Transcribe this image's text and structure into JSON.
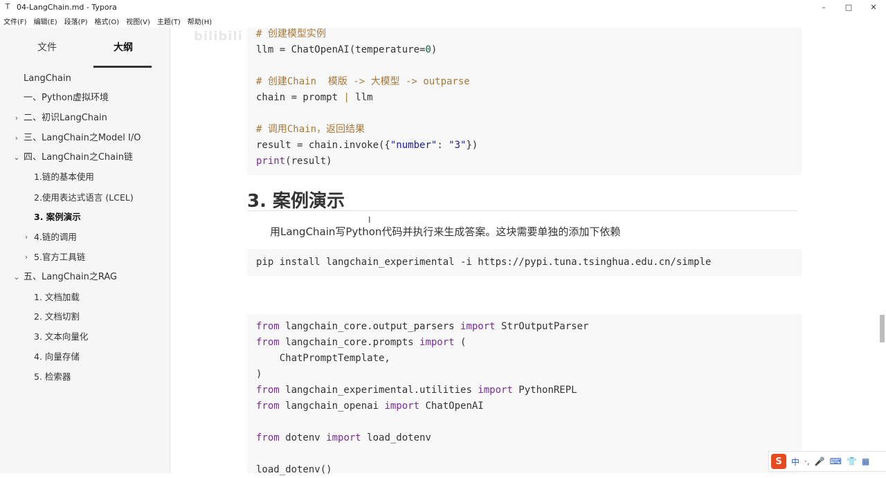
{
  "window": {
    "title": "04-LangChain.md - Typora",
    "app_icon": "T",
    "controls": [
      "–",
      "□",
      "✕"
    ]
  },
  "menu": [
    "文件(F)",
    "编辑(E)",
    "段落(P)",
    "格式(O)",
    "视图(V)",
    "主题(T)",
    "帮助(H)"
  ],
  "sidebar": {
    "tabs": {
      "files": "文件",
      "outline": "大纲"
    },
    "outline": [
      {
        "label": "LangChain",
        "chevron": ""
      },
      {
        "label": "一、Python虚拟环境",
        "chevron": ""
      },
      {
        "label": "二、初识LangChain",
        "chevron": "›"
      },
      {
        "label": "三、LangChain之Model I/O",
        "chevron": "›"
      },
      {
        "label": "四、LangChain之Chain链",
        "chevron": "⌄"
      },
      {
        "label": "1.链的基本使用",
        "chevron": ""
      },
      {
        "label": "2.使用表达式语言 (LCEL)",
        "chevron": ""
      },
      {
        "label": "3. 案例演示",
        "chevron": ""
      },
      {
        "label": "4.链的调用",
        "chevron": "›"
      },
      {
        "label": "5.官方工具链",
        "chevron": "›"
      },
      {
        "label": "五、LangChain之RAG",
        "chevron": "⌄"
      },
      {
        "label": "1. 文档加载",
        "chevron": ""
      },
      {
        "label": "2. 文档切割",
        "chevron": ""
      },
      {
        "label": "3. 文本向量化",
        "chevron": ""
      },
      {
        "label": "4. 向量存储",
        "chevron": ""
      },
      {
        "label": "5. 检索器",
        "chevron": ""
      }
    ],
    "footer": {
      "back": "‹",
      "source": "</>"
    }
  },
  "editor": {
    "code1": {
      "l1": "# 创建模型实例",
      "l2a": "llm = ChatOpenAI(temperature=",
      "l2b": "0",
      "l2c": ")",
      "l4": "# 创建Chain  模版 -> 大模型 -> outparse",
      "l5a": "chain = prompt ",
      "l5b": "|",
      "l5c": " llm",
      "l7": "# 调用Chain，返回结果",
      "l8a": "result = chain.invoke({",
      "l8b": "\"number\"",
      "l8c": ": ",
      "l8d": "\"3\"",
      "l8e": "})",
      "l9a": "print",
      "l9b": "(result)"
    },
    "heading": "3. 案例演示",
    "paragraph": "用LangChain写Python代码并执行来生成答案。这块需要单独的添加下依赖",
    "pip": "pip install langchain_experimental -i https://pypi.tuna.tsinghua.edu.cn/simple",
    "code2": {
      "from": "from",
      "import": "import",
      "m1": " langchain_core.output_parsers ",
      "n1": " StrOutputParser",
      "m2": " langchain_core.prompts ",
      "n2": " (",
      "l3": "    ChatPromptTemplate,",
      "l4": ")",
      "m5": " langchain_experimental.utilities ",
      "n5": " PythonREPL",
      "m6": " langchain_openai ",
      "n6": " ChatOpenAI",
      "m8": " dotenv ",
      "n8": " load_dotenv",
      "l10": "load_dotenv()"
    },
    "cursor": "I"
  },
  "ime": {
    "logo": "S",
    "items": [
      "中",
      "·,",
      "🎤",
      "⌨",
      "👕",
      "▦"
    ]
  },
  "watermark": "bilibili"
}
